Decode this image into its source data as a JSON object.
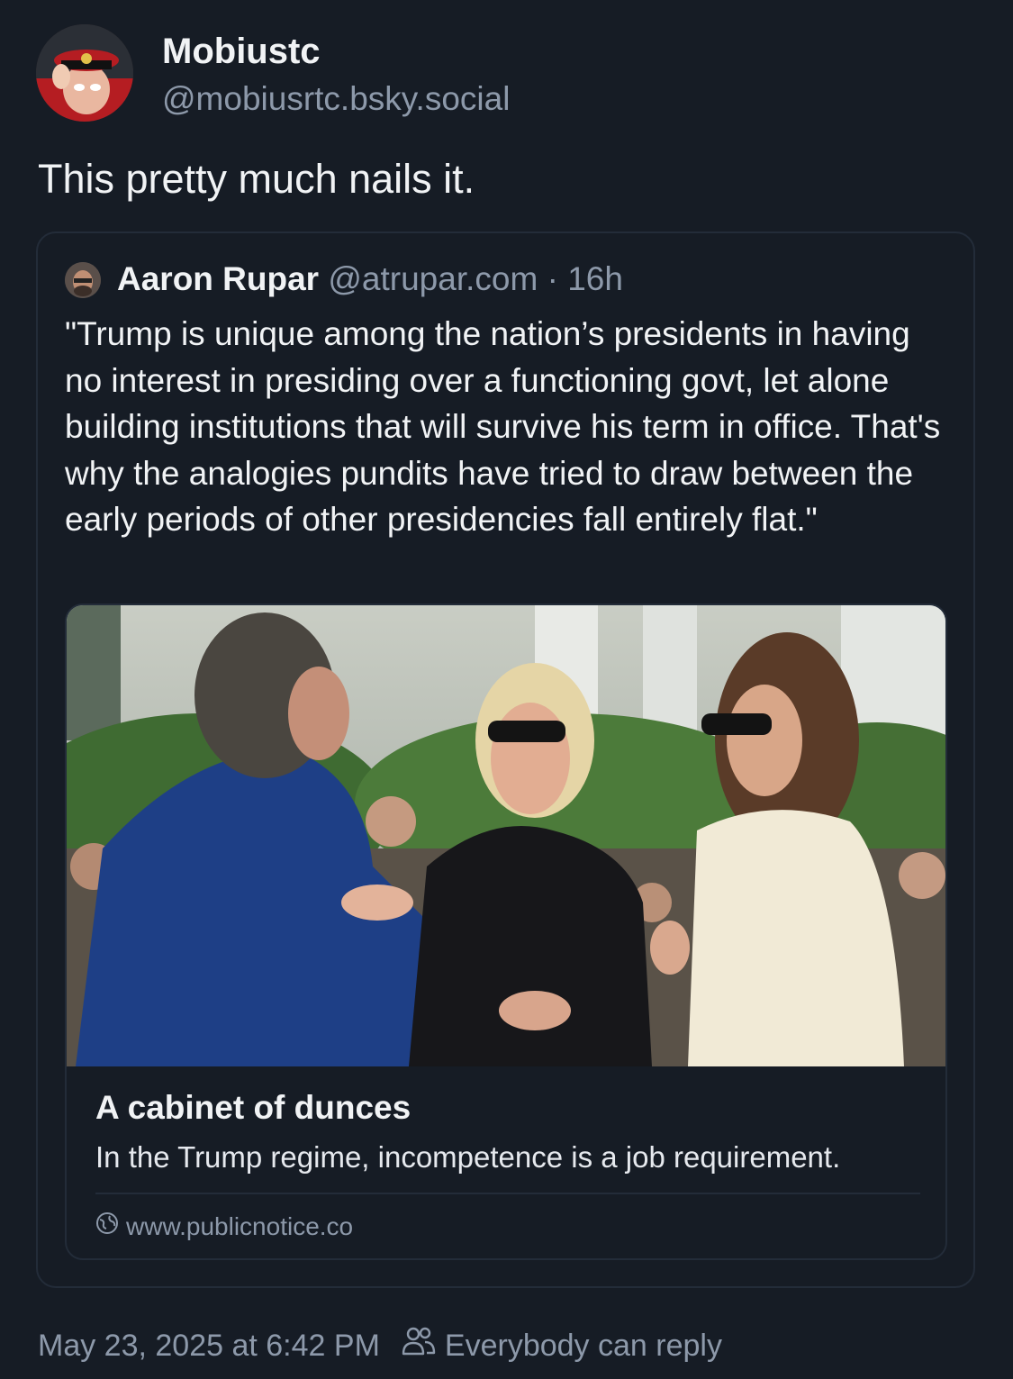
{
  "author": {
    "display_name": "Mobiustc",
    "handle": "@mobiusrtc.bsky.social",
    "avatar_icon": "avatar-image"
  },
  "post": {
    "text": "This pretty much nails it."
  },
  "quoted_post": {
    "author_name": "Aaron Rupar",
    "author_handle": "@atrupar.com",
    "separator": "·",
    "time_ago": "16h",
    "text": "\"Trump is unique among the nation’s presidents in having no interest in presiding over a functioning govt, let alone building institutions that will survive his term in office. That's why the analogies pundits have tried to draw between the early periods of other presidencies fall entirely flat.\"",
    "link_card": {
      "title": "A cabinet of dunces",
      "description": "In the Trump regime, incompetence is a job requirement.",
      "domain": "www.publicnotice.co",
      "domain_icon": "globe-icon"
    }
  },
  "footer": {
    "timestamp": "May 23, 2025 at 6:42 PM",
    "reply_setting": "Everybody can reply",
    "reply_icon": "people-icon"
  },
  "colors": {
    "background": "#161c25",
    "border": "#232c39",
    "text_primary": "#f1f3f5",
    "text_secondary": "#8d99aa"
  }
}
